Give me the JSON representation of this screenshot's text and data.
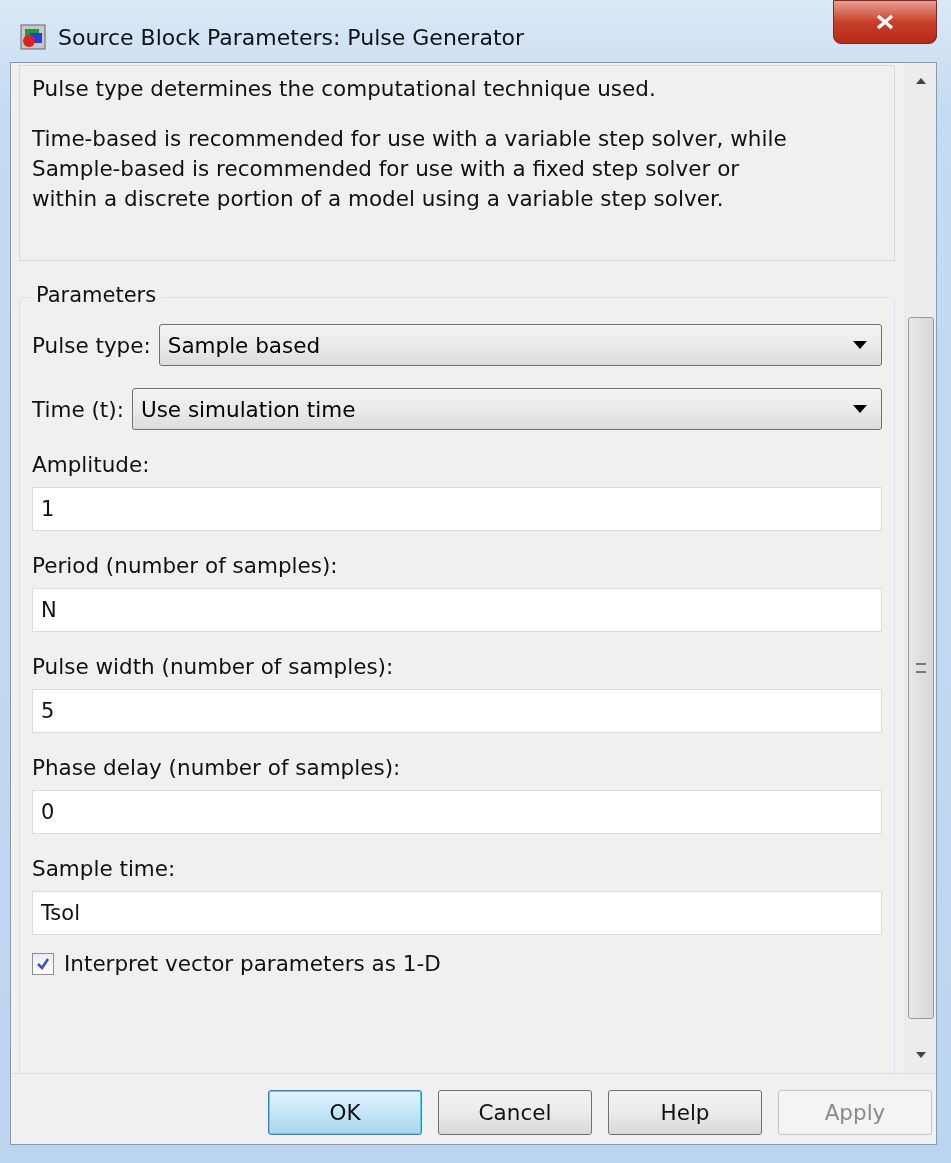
{
  "window": {
    "title": "Source Block Parameters: Pulse Generator"
  },
  "description": [
    "Pulse type determines the computational technique used.",
    "Time-based is recommended for use with a variable step solver, while Sample-based is recommended for use with a fixed step solver or within a discrete portion of a model using a variable step solver."
  ],
  "parameters": {
    "title": "Parameters",
    "dropdowns": [
      {
        "label": "Pulse type:",
        "value": "Sample based"
      },
      {
        "label": "Time (t):",
        "value": "Use simulation time"
      }
    ],
    "fields": [
      {
        "label": "Amplitude:",
        "value": "1"
      },
      {
        "label": "Period (number of samples):",
        "value": "N"
      },
      {
        "label": "Pulse width (number of samples):",
        "value": "5"
      },
      {
        "label": "Phase delay (number of samples):",
        "value": "0"
      },
      {
        "label": "Sample time:",
        "value": "Tsol"
      }
    ],
    "checkbox": {
      "label": "Interpret vector parameters as 1-D",
      "checked": true
    }
  },
  "buttons": [
    {
      "label": "OK",
      "default": true,
      "disabled": false
    },
    {
      "label": "Cancel",
      "default": false,
      "disabled": false
    },
    {
      "label": "Help",
      "default": false,
      "disabled": false
    },
    {
      "label": "Apply",
      "default": false,
      "disabled": true
    }
  ]
}
